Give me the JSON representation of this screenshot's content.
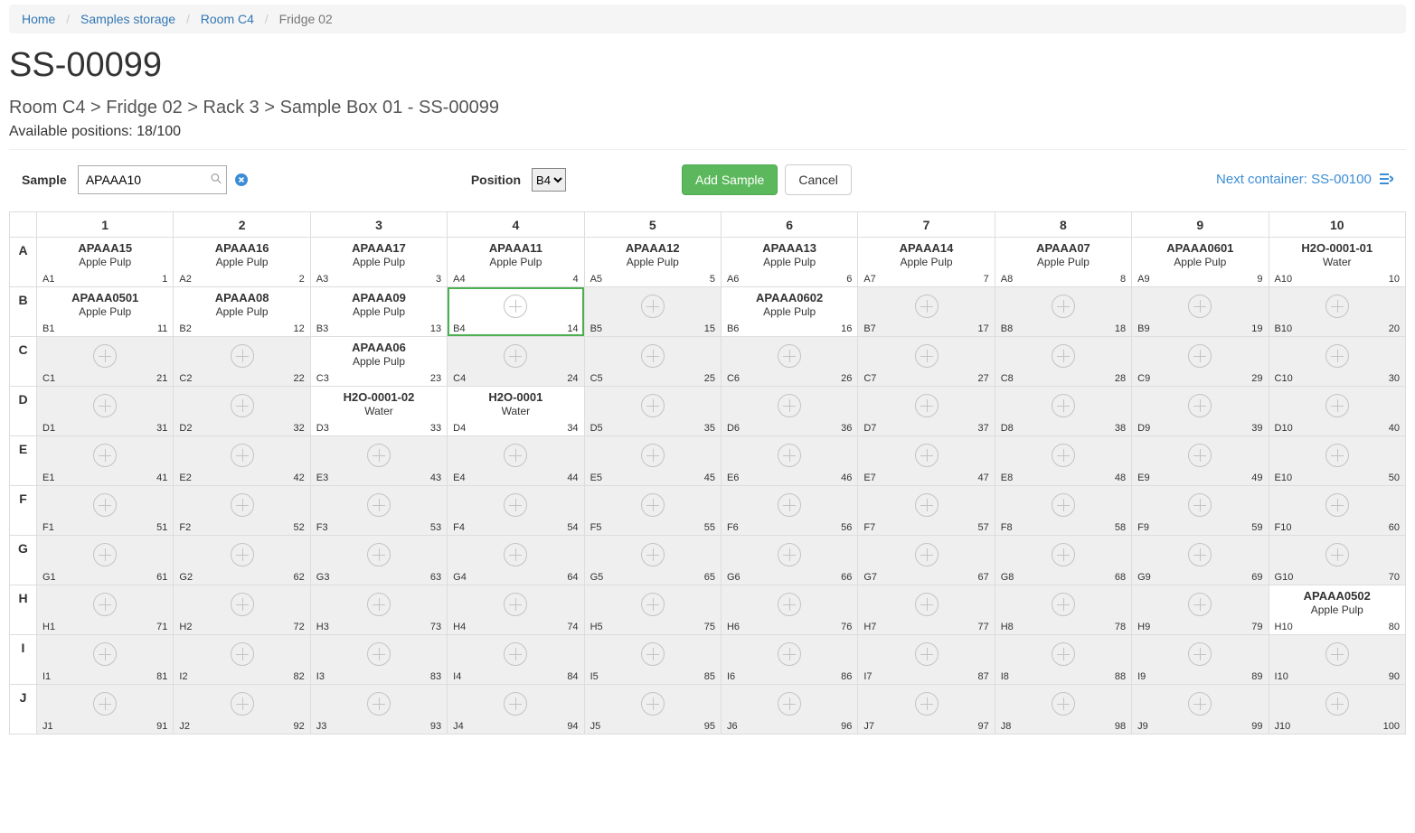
{
  "breadcrumb": [
    {
      "label": "Home",
      "link": true
    },
    {
      "label": "Samples storage",
      "link": true
    },
    {
      "label": "Room C4",
      "link": true
    },
    {
      "label": "Fridge 02",
      "link": false
    }
  ],
  "title": "SS-00099",
  "path_line": "Room C4 > Fridge 02 > Rack 3 > Sample Box 01 - SS-00099",
  "available_positions": "Available positions: 18/100",
  "toolbar": {
    "sample_label": "Sample",
    "sample_value": "APAAA10",
    "position_label": "Position",
    "position_value": "B4",
    "add_label": "Add Sample",
    "cancel_label": "Cancel",
    "next_label": "Next container: ",
    "next_value": "SS-00100"
  },
  "grid": {
    "rows": [
      "A",
      "B",
      "C",
      "D",
      "E",
      "F",
      "G",
      "H",
      "I",
      "J"
    ],
    "cols": 10,
    "selected": "B4",
    "samples": {
      "A1": {
        "name": "APAAA15",
        "type": "Apple Pulp"
      },
      "A2": {
        "name": "APAAA16",
        "type": "Apple Pulp"
      },
      "A3": {
        "name": "APAAA17",
        "type": "Apple Pulp"
      },
      "A4": {
        "name": "APAAA11",
        "type": "Apple Pulp"
      },
      "A5": {
        "name": "APAAA12",
        "type": "Apple Pulp"
      },
      "A6": {
        "name": "APAAA13",
        "type": "Apple Pulp"
      },
      "A7": {
        "name": "APAAA14",
        "type": "Apple Pulp"
      },
      "A8": {
        "name": "APAAA07",
        "type": "Apple Pulp"
      },
      "A9": {
        "name": "APAAA0601",
        "type": "Apple Pulp"
      },
      "A10": {
        "name": "H2O-0001-01",
        "type": "Water"
      },
      "B1": {
        "name": "APAAA0501",
        "type": "Apple Pulp"
      },
      "B2": {
        "name": "APAAA08",
        "type": "Apple Pulp"
      },
      "B3": {
        "name": "APAAA09",
        "type": "Apple Pulp"
      },
      "B6": {
        "name": "APAAA0602",
        "type": "Apple Pulp"
      },
      "C3": {
        "name": "APAAA06",
        "type": "Apple Pulp"
      },
      "D3": {
        "name": "H2O-0001-02",
        "type": "Water"
      },
      "D4": {
        "name": "H2O-0001",
        "type": "Water"
      },
      "H10": {
        "name": "APAAA0502",
        "type": "Apple Pulp"
      }
    }
  }
}
